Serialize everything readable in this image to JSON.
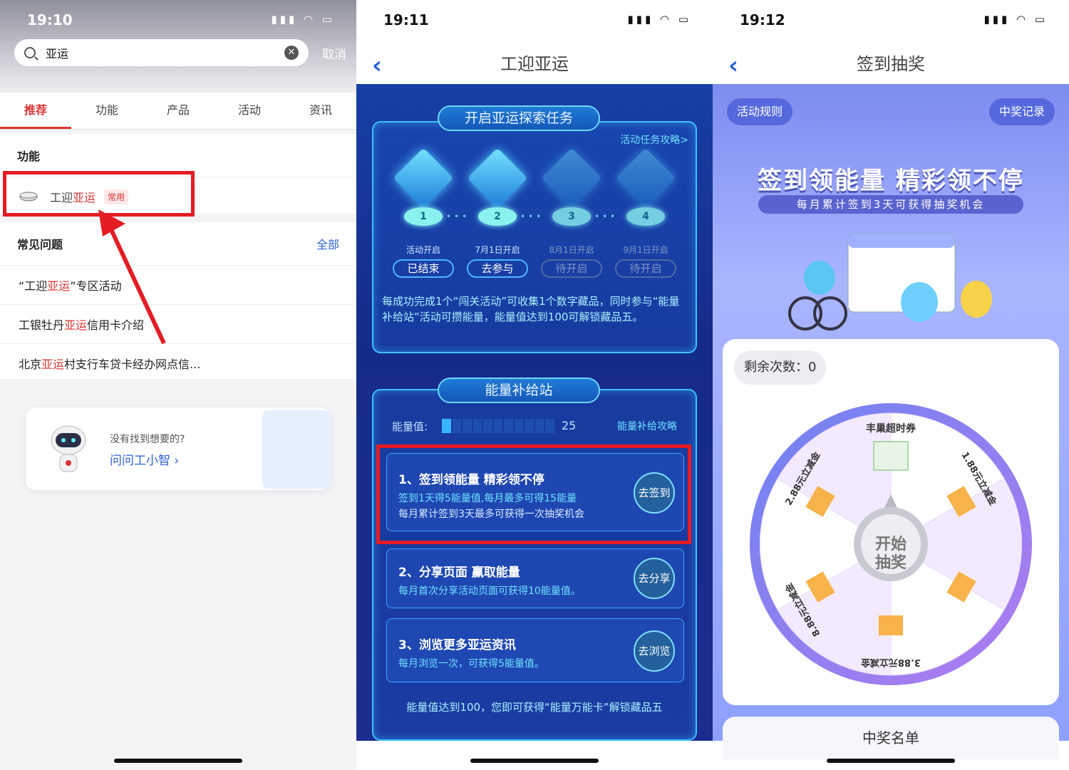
{
  "panel1": {
    "time": "19:10",
    "search_query": "亚运",
    "cancel": "取消",
    "tabs": [
      "推荐",
      "功能",
      "产品",
      "活动",
      "资讯"
    ],
    "function_section": {
      "title": "功能",
      "item_prefix": "工迎",
      "item_hl": "亚运",
      "badge": "常用"
    },
    "faq_section": {
      "title": "常见问题",
      "more": "全部",
      "rows": [
        {
          "pre": "“工迎",
          "hl": "亚运",
          "post": "”专区活动"
        },
        {
          "pre": "工银牡丹",
          "hl": "亚运",
          "post": "信用卡介绍"
        },
        {
          "pre": "北京",
          "hl": "亚运",
          "post": "村支行车贷卡经办网点信..."
        }
      ]
    },
    "help": {
      "line1": "没有找到想要的?",
      "line2": "问问工小智 ›"
    }
  },
  "panel2": {
    "time": "19:11",
    "title": "工迎亚运",
    "tasks_frame": {
      "title": "开启亚运探索任务",
      "link": "活动任务攻略>",
      "stages": [
        {
          "num": "1",
          "label": "活动开启",
          "status": "已结束"
        },
        {
          "num": "2",
          "label": "7月1日开启",
          "status": "去参与"
        },
        {
          "num": "3",
          "label": "8月1日开启",
          "status": "待开启"
        },
        {
          "num": "4",
          "label": "9月1日开启",
          "status": "待开启"
        }
      ],
      "desc": "每成功完成1个“闯关活动”可收集1个数字藏品，同时参与“能量补给站”活动可攒能量，能量值达到100可解锁藏品五。"
    },
    "energy_frame": {
      "title": "能量补给站",
      "energy_label": "能量值:",
      "energy_value": "25",
      "energy_fraction": 0.25,
      "guide": "能量补给攻略",
      "tasks": [
        {
          "title": "1、签到领能量 精彩领不停",
          "desc1": "签到1天得5能量值,每月最多可得15能量",
          "desc2": "每月累计签到3天最多可获得一次抽奖机会",
          "button": "去签到"
        },
        {
          "title": "2、分享页面 赢取能量",
          "desc1": "每月首次分享活动页面可获得10能量值。",
          "button": "去分享"
        },
        {
          "title": "3、浏览更多亚运资讯",
          "desc1": "每月浏览一次，可获得5能量值。",
          "button": "去浏览"
        }
      ],
      "footer": "能量值达到100，您即可获得“能量万能卡”解锁藏品五"
    }
  },
  "panel3": {
    "time": "19:12",
    "title": "签到抽奖",
    "rules": "活动规则",
    "records": "中奖记录",
    "banner_main": "签到领能量 精彩领不停",
    "banner_sub": "每月累计签到3天可获得抽奖机会",
    "remaining": "剩余次数：0",
    "wheel_center": "开始抽奖",
    "wheel_segments": [
      "丰巢超时券",
      "1.88元立减金",
      "",
      "3.88元立减金",
      "8.88元立减金",
      "2.88元立减金"
    ],
    "winners_title": "中奖名单"
  }
}
